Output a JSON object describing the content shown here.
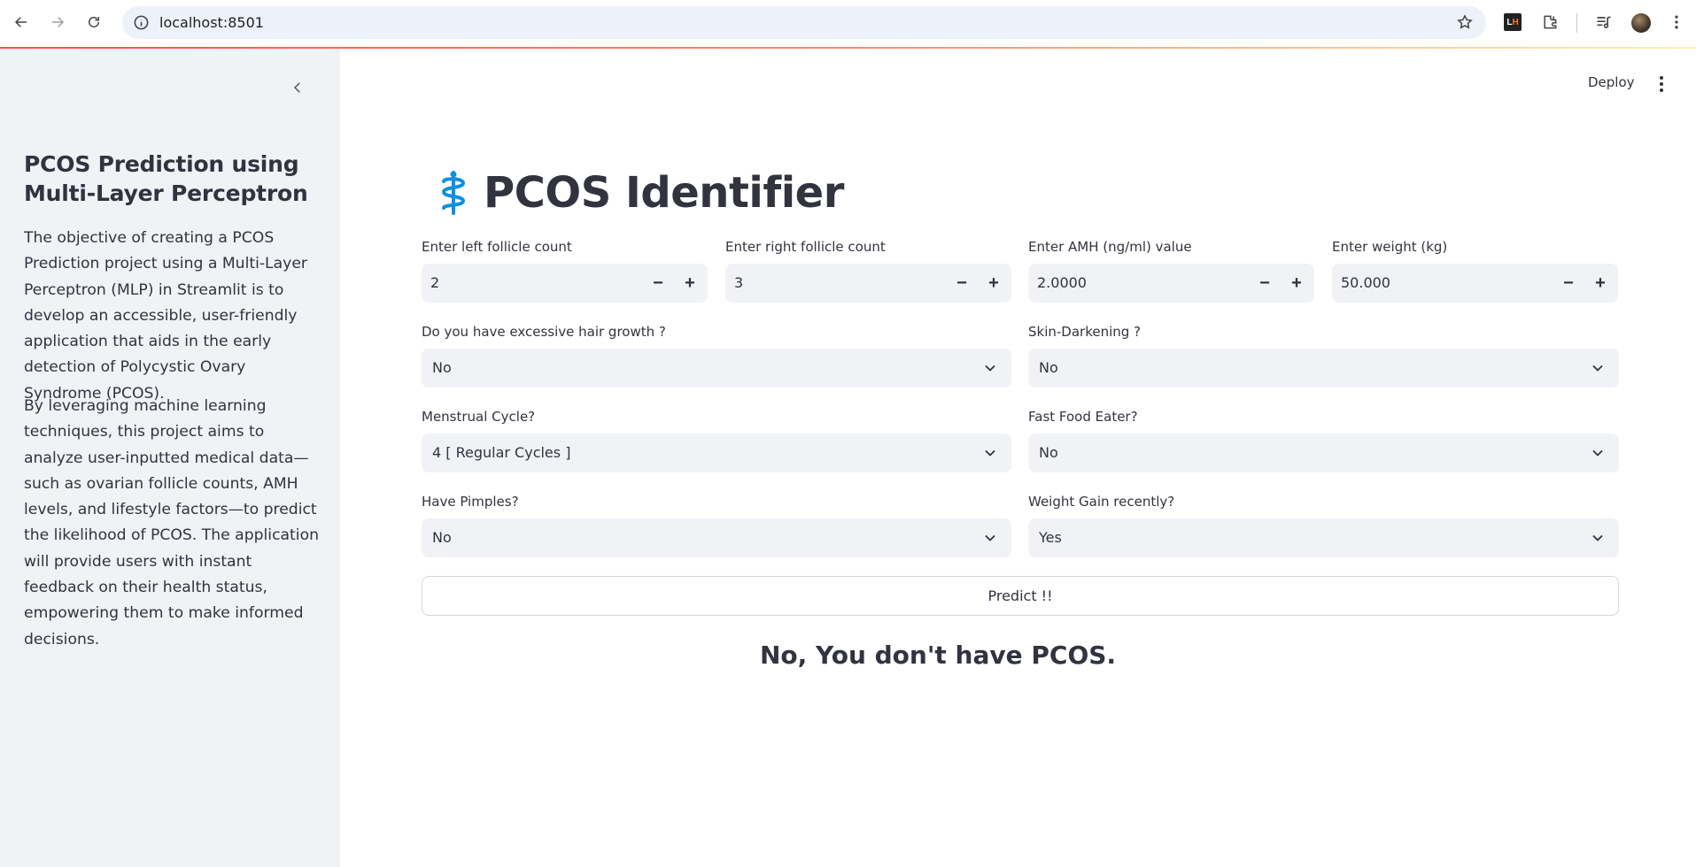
{
  "browser": {
    "url": "localhost:8501",
    "extension_badge": [
      "L",
      "H"
    ]
  },
  "sidebar": {
    "title": "PCOS Prediction using Multi-Layer Perceptron",
    "paragraph1": "The objective of creating a PCOS Prediction project using a Multi-Layer Perceptron (MLP) in Streamlit is to develop an accessible, user-friendly application that aids in the early detection of Polycystic Ovary Syndrome (PCOS).",
    "paragraph2": "By leveraging machine learning techniques, this project aims to analyze user-inputted medical data—such as ovarian follicle counts, AMH levels, and lifestyle factors—to predict the likelihood of PCOS. The application will provide users with instant feedback on their health status, empowering them to make informed decisions."
  },
  "toolbar": {
    "deploy_label": "Deploy"
  },
  "main": {
    "title": "PCOS Identifier",
    "title_icon": "caduceus-icon",
    "number_inputs": [
      {
        "label": "Enter left follicle count",
        "value": "2"
      },
      {
        "label": "Enter right follicle count",
        "value": "3"
      },
      {
        "label": "Enter AMH (ng/ml) value",
        "value": "2.0000"
      },
      {
        "label": "Enter weight (kg)",
        "value": "50.000"
      }
    ],
    "selects": [
      {
        "label": "Do you have excessive hair growth ?",
        "value": "No"
      },
      {
        "label": "Skin-Darkening ?",
        "value": "No"
      },
      {
        "label": "Menstrual Cycle?",
        "value": "4 [ Regular Cycles ]"
      },
      {
        "label": "Fast Food Eater?",
        "value": "No"
      },
      {
        "label": "Have Pimples?",
        "value": "No"
      },
      {
        "label": "Weight Gain recently?",
        "value": "Yes"
      }
    ],
    "predict_label": "Predict !!",
    "result": "No, You don't have PCOS."
  },
  "colors": {
    "accent_line": [
      "#ff4b4b",
      "#fff3a4"
    ],
    "sidebar_bg": "#f0f2f6",
    "input_bg": "#f0f2f6",
    "icon_blue": "#0f8fe0",
    "text": "#31333f"
  }
}
